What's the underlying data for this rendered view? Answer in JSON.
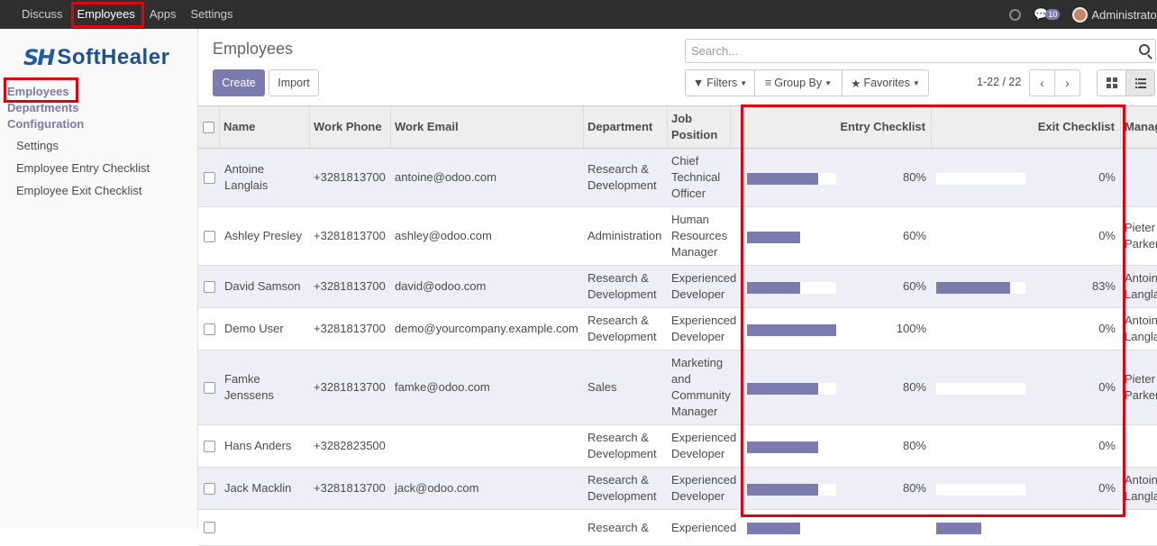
{
  "topbar": {
    "menu": [
      "Discuss",
      "Employees",
      "Apps",
      "Settings"
    ],
    "active": "Employees",
    "chat_count": "10",
    "user": "Administrator"
  },
  "sidebar": {
    "logo_text": "SoftHealer",
    "logo_mark": "SH",
    "sections": [
      "Employees",
      "Departments",
      "Configuration"
    ],
    "config_items": [
      "Settings",
      "Employee Entry Checklist",
      "Employee Exit Checklist"
    ]
  },
  "control_panel": {
    "title": "Employees",
    "create_label": "Create",
    "import_label": "Import",
    "search_placeholder": "Search...",
    "filters_label": "Filters",
    "groupby_label": "Group By",
    "favorites_label": "Favorites",
    "pager": "1-22 / 22"
  },
  "table": {
    "headers": [
      "Name",
      "Work Phone",
      "Work Email",
      "Department",
      "Job Position",
      "Entry Checklist",
      "Exit Checklist",
      "Manager"
    ],
    "rows": [
      {
        "name": [
          "Antoine",
          "Langlais"
        ],
        "phone": "+3281813700",
        "email": "antoine@odoo.com",
        "dept": [
          "Research &",
          "Development"
        ],
        "job": [
          "Chief",
          "Technical",
          "Officer"
        ],
        "entry": 80,
        "entry_label": "80%",
        "exit": 0,
        "exit_label": "0%",
        "manager": []
      },
      {
        "name": [
          "Ashley Presley"
        ],
        "phone": "+3281813700",
        "email": "ashley@odoo.com",
        "dept": [
          "Administration"
        ],
        "job": [
          "Human",
          "Resources",
          "Manager"
        ],
        "entry": 60,
        "entry_label": "60%",
        "exit": 0,
        "exit_label": "0%",
        "manager": [
          "Pieter",
          "Parker"
        ]
      },
      {
        "name": [
          "David Samson"
        ],
        "phone": "+3281813700",
        "email": "david@odoo.com",
        "dept": [
          "Research &",
          "Development"
        ],
        "job": [
          "Experienced",
          "Developer"
        ],
        "entry": 60,
        "entry_label": "60%",
        "exit": 83,
        "exit_label": "83%",
        "manager": [
          "Antoine",
          "Langlais"
        ]
      },
      {
        "name": [
          "Demo User"
        ],
        "phone": "+3281813700",
        "email": "demo@yourcompany.example.com",
        "dept": [
          "Research &",
          "Development"
        ],
        "job": [
          "Experienced",
          "Developer"
        ],
        "entry": 100,
        "entry_label": "100%",
        "exit": 0,
        "exit_label": "0%",
        "manager": [
          "Antoine",
          "Langlais"
        ]
      },
      {
        "name": [
          "Famke",
          "Jenssens"
        ],
        "phone": "+3281813700",
        "email": "famke@odoo.com",
        "dept": [
          "Sales"
        ],
        "job": [
          "Marketing",
          "and",
          "Community",
          "Manager"
        ],
        "entry": 80,
        "entry_label": "80%",
        "exit": 0,
        "exit_label": "0%",
        "manager": [
          "Pieter",
          "Parker"
        ]
      },
      {
        "name": [
          "Hans Anders"
        ],
        "phone": "+3282823500",
        "email": "",
        "dept": [
          "Research &",
          "Development"
        ],
        "job": [
          "Experienced",
          "Developer"
        ],
        "entry": 80,
        "entry_label": "80%",
        "exit": 0,
        "exit_label": "0%",
        "manager": []
      },
      {
        "name": [
          "Jack Macklin"
        ],
        "phone": "+3281813700",
        "email": "jack@odoo.com",
        "dept": [
          "Research &",
          "Development"
        ],
        "job": [
          "Experienced",
          "Developer"
        ],
        "entry": 80,
        "entry_label": "80%",
        "exit": 0,
        "exit_label": "0%",
        "manager": [
          "Antoine",
          "Langlais"
        ]
      },
      {
        "name": [
          ""
        ],
        "phone": "",
        "email": "",
        "dept": [
          "Research &"
        ],
        "job": [
          "Experienced"
        ],
        "entry": 60,
        "entry_label": "",
        "exit": 50,
        "exit_label": "",
        "manager": []
      }
    ]
  },
  "colors": {
    "accent": "#7c7bad",
    "highlight": "#e3000f",
    "topbar": "#2f2f2f"
  }
}
